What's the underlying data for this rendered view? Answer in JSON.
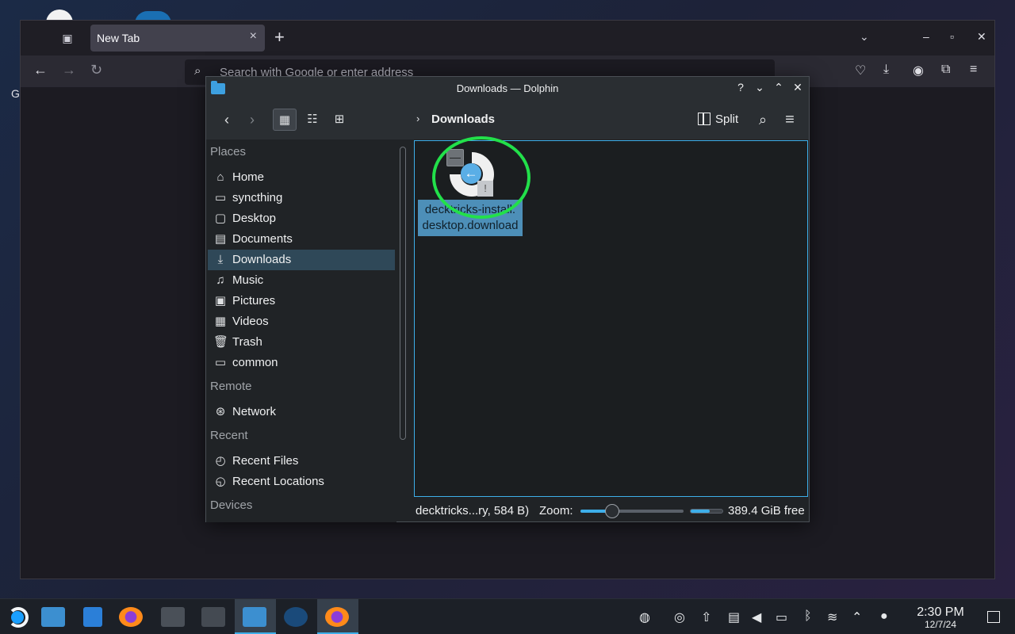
{
  "firefox": {
    "tab_title": "New Tab",
    "tab_close": "×",
    "new_tab": "+",
    "url_placeholder": "Search with Google or enter address",
    "content_letter": "G"
  },
  "dolphin": {
    "window_title": "Downloads — Dolphin",
    "breadcrumb": "Downloads",
    "split_label": "Split",
    "places_header": "Places",
    "places": [
      {
        "label": "Home",
        "icon": "home-icon"
      },
      {
        "label": "syncthing",
        "icon": "folder-icon"
      },
      {
        "label": "Desktop",
        "icon": "desktop-icon"
      },
      {
        "label": "Documents",
        "icon": "documents-icon"
      },
      {
        "label": "Downloads",
        "icon": "download-icon"
      },
      {
        "label": "Music",
        "icon": "music-icon"
      },
      {
        "label": "Pictures",
        "icon": "pictures-icon"
      },
      {
        "label": "Videos",
        "icon": "videos-icon"
      },
      {
        "label": "Trash",
        "icon": "trash-icon"
      },
      {
        "label": "common",
        "icon": "folder-icon"
      }
    ],
    "remote_header": "Remote",
    "remote": [
      {
        "label": "Network",
        "icon": "network-icon"
      }
    ],
    "recent_header": "Recent",
    "recent": [
      {
        "label": "Recent Files",
        "icon": "recent-files-icon"
      },
      {
        "label": "Recent Locations",
        "icon": "recent-locations-icon"
      }
    ],
    "devices_header": "Devices",
    "file": {
      "line1": "decktricks-install.",
      "line2": "desktop.download"
    },
    "status": {
      "selection": "decktricks...ry, 584 B)",
      "zoom_label": "Zoom:",
      "zoom_level": 0.28,
      "free_space": "389.4 GiB free",
      "disk_used_fraction": 0.6
    }
  },
  "taskbar": {
    "time": "2:30 PM",
    "date": "12/7/24"
  },
  "colors": {
    "accent": "#3daee9",
    "selection": "#4d8fb8",
    "highlight_ring": "#22e04a"
  }
}
